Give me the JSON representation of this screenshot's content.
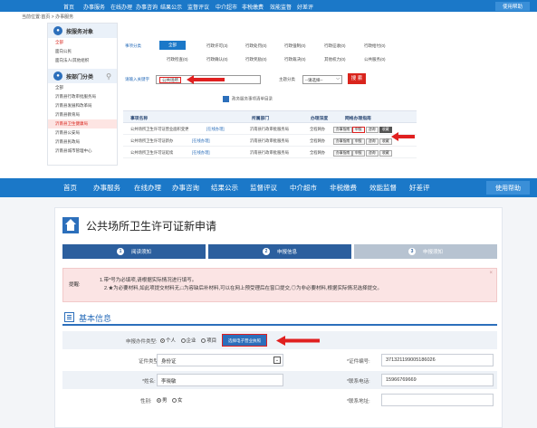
{
  "shot1": {
    "nav": [
      "首页",
      "办事服务",
      "在线办理",
      "办事咨询",
      "结果公示",
      "监督评议",
      "中介超市",
      "非税缴费",
      "效能监督",
      "好差评"
    ],
    "help": "使用帮助",
    "breadcrumb": "当前位置:首页 > 办事服务",
    "sidebar": {
      "heading1": "按服务对象",
      "items1": [
        "全部",
        "面向公民",
        "面向法人/其他组织"
      ],
      "heading2": "按部门分类",
      "items2": [
        "全部",
        "沂南县行政审批服务局",
        "沂南县发展和改革局",
        "沂南县教育局",
        "沂南县卫生健康局",
        "沂南县公安局",
        "沂南县民政局",
        "沂南县城市管理中心"
      ]
    },
    "filter": {
      "category_label": "事项分类",
      "categories_row1": [
        "全部",
        "行政许可(3)",
        "行政处罚(0)",
        "行政强制(0)",
        "行政征收(0)",
        "行政给付(0)"
      ],
      "categories_row2": [
        "行政检查(0)",
        "行政确认(0)",
        "行政奖励(0)",
        "行政裁决(0)",
        "其他权力(0)",
        "公共服务(0)"
      ],
      "keyword_label": "请输入关键字",
      "keyword_value": "公共场所",
      "theme_label": "主题分类",
      "theme_value": "--请选择--",
      "search_button": "搜 索"
    },
    "guide_link": "政务服务事项清单目录",
    "table": {
      "headers": [
        "事项名称",
        "所属部门",
        "办理深度",
        "网络办理指南"
      ],
      "rows": [
        {
          "name": "公共场所卫生许可证营业面积变更",
          "tag": "[在线办理]",
          "dept": "沂南县行政审批服务局",
          "depth": "全程网办"
        },
        {
          "name": "公共场所卫生许可证新办",
          "tag": "[在线办理]",
          "dept": "沂南县行政审批服务局",
          "depth": "全程网办"
        },
        {
          "name": "公共场所卫生许可证延续",
          "tag": "[在线办理]",
          "dept": "沂南县行政审批服务局",
          "depth": "全程网办"
        }
      ],
      "buttons": [
        "办事指南",
        "申报",
        "咨询",
        "收藏"
      ]
    }
  },
  "shot2": {
    "nav": [
      "首页",
      "办事服务",
      "在线办理",
      "办事咨询",
      "结果公示",
      "监督评议",
      "中介超市",
      "非税缴费",
      "效能监督",
      "好差评"
    ],
    "help": "使用帮助",
    "page_title": "公共场所卫生许可证新申请",
    "steps": [
      {
        "n": "1",
        "label": "阅读须知"
      },
      {
        "n": "2",
        "label": "申报信息"
      },
      {
        "n": "3",
        "label": "申报须知"
      }
    ],
    "notice": {
      "label": "提醒:",
      "line1": "1.带*号为必填项,请根据实际情况进行填写。",
      "line2": "2.★为必要材料,如此项提交材料无,□为容缺后补材料,可以在网上预受理后在窗口提交,◎为非必要材料,根据实际情况选择提交。"
    },
    "section_title": "基本信息",
    "form": {
      "applicant_type_label": "申报办件类型:",
      "applicant_types": [
        "个人",
        "企业",
        "项目"
      ],
      "pick_button": "选择电子营业执照",
      "id_type_label": "证件类型:",
      "id_type_value": "身份证",
      "id_number_label": "*证件编号:",
      "id_number_value": "371321199005186026",
      "name_label": "*姓名:",
      "name_value": "李晓敏",
      "phone_label": "*联系电话:",
      "phone_value": "15966769669",
      "gender_label": "性别:",
      "genders": [
        "男",
        "女"
      ],
      "address_label": "*联系地址:"
    }
  }
}
